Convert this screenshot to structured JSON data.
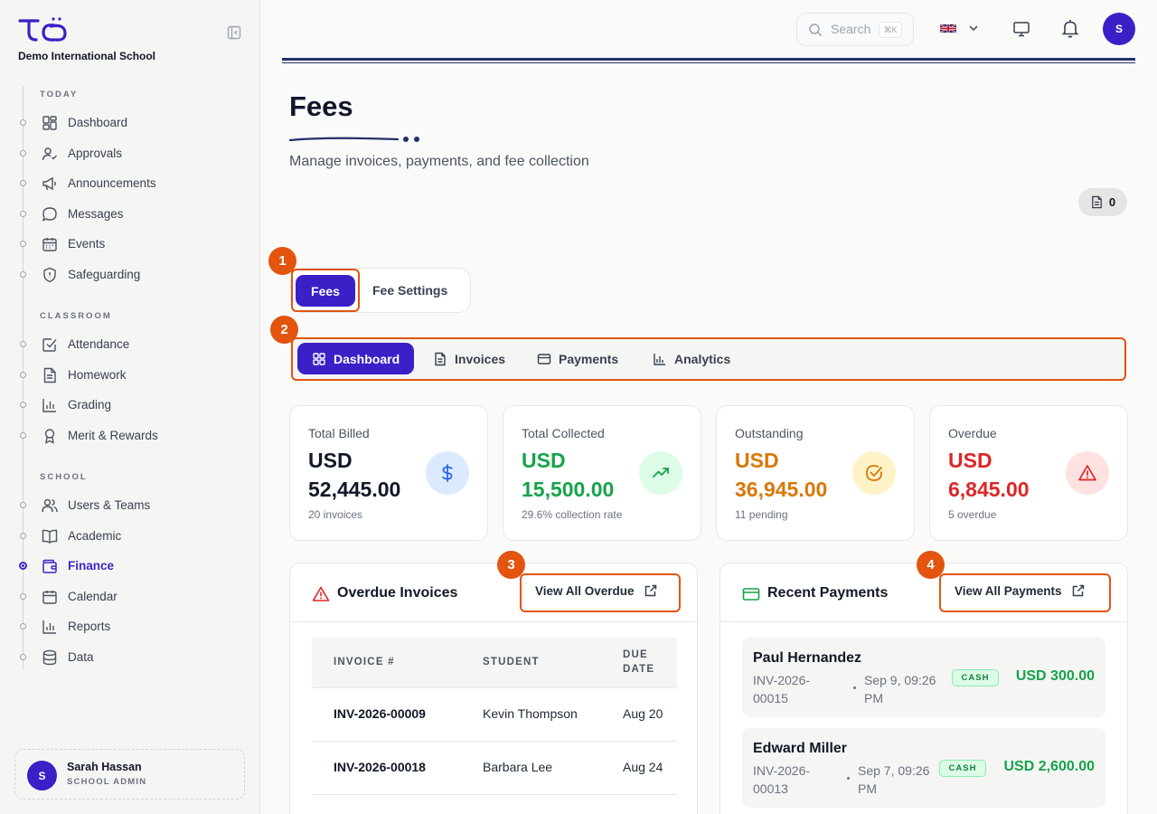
{
  "sidebar": {
    "school_name": "Demo International School",
    "sections": {
      "today": "TODAY",
      "classroom": "CLASSROOM",
      "school": "SCHOOL"
    },
    "items": [
      {
        "label": "Dashboard",
        "icon": "dashboard-icon"
      },
      {
        "label": "Approvals",
        "icon": "user-check-icon"
      },
      {
        "label": "Announcements",
        "icon": "megaphone-icon"
      },
      {
        "label": "Messages",
        "icon": "message-icon"
      },
      {
        "label": "Events",
        "icon": "calendar-icon"
      },
      {
        "label": "Safeguarding",
        "icon": "shield-icon"
      },
      {
        "label": "Attendance",
        "icon": "checkbox-icon"
      },
      {
        "label": "Homework",
        "icon": "document-icon"
      },
      {
        "label": "Grading",
        "icon": "bar-chart-icon"
      },
      {
        "label": "Merit & Rewards",
        "icon": "award-icon"
      },
      {
        "label": "Users & Teams",
        "icon": "users-icon"
      },
      {
        "label": "Academic",
        "icon": "book-icon"
      },
      {
        "label": "Finance",
        "icon": "wallet-icon",
        "active": true
      },
      {
        "label": "Calendar",
        "icon": "calendar-icon"
      },
      {
        "label": "Reports",
        "icon": "bar-chart-icon"
      },
      {
        "label": "Data",
        "icon": "database-icon"
      }
    ],
    "user": {
      "initial": "S",
      "name": "Sarah Hassan",
      "role": "SCHOOL ADMIN"
    }
  },
  "topbar": {
    "search_placeholder": "Search",
    "search_shortcut": "⌘K",
    "avatar_initial": "S"
  },
  "header": {
    "title": "Fees",
    "subtitle": "Manage invoices, payments, and fee collection",
    "doc_count": "0"
  },
  "markers": [
    "1",
    "2",
    "3",
    "4"
  ],
  "tabs": {
    "primary": [
      "Fees",
      "Fee Settings"
    ],
    "secondary": [
      "Dashboard",
      "Invoices",
      "Payments",
      "Analytics"
    ]
  },
  "stats": [
    {
      "label": "Total Billed",
      "currency": "USD",
      "value": "52,445.00",
      "sub": "20 invoices",
      "color": "#111827"
    },
    {
      "label": "Total Collected",
      "currency": "USD",
      "value": "15,500.00",
      "sub": "29.6% collection rate",
      "color": "#16a34a"
    },
    {
      "label": "Outstanding",
      "currency": "USD",
      "value": "36,945.00",
      "sub": "11 pending",
      "color": "#d97706"
    },
    {
      "label": "Overdue",
      "currency": "USD",
      "value": "6,845.00",
      "sub": "5 overdue",
      "color": "#dc2626"
    }
  ],
  "overdue": {
    "title": "Overdue Invoices",
    "view_all": "View All Overdue",
    "columns": [
      "INVOICE #",
      "STUDENT",
      "DUE",
      "DATE"
    ],
    "rows": [
      {
        "invoice": "INV-2026-00009",
        "student": "Kevin Thompson",
        "due": "Aug 20"
      },
      {
        "invoice": "INV-2026-00018",
        "student": "Barbara Lee",
        "due": "Aug 24"
      }
    ]
  },
  "payments": {
    "title": "Recent Payments",
    "view_all": "View All Payments",
    "items": [
      {
        "name": "Paul Hernandez",
        "invoice": "INV-2026-00015",
        "date": "Sep 9, 09:26 PM",
        "method": "CASH",
        "amount": "USD 300.00"
      },
      {
        "name": "Edward Miller",
        "invoice": "INV-2026-00013",
        "date": "Sep 7, 09:26 PM",
        "method": "CASH",
        "amount": "USD 2,600.00"
      }
    ]
  },
  "colors": {
    "brand": "#3b1fc7",
    "accent_marker": "#e3540f",
    "success": "#16a34a",
    "warning": "#d97706",
    "danger": "#dc2626"
  }
}
